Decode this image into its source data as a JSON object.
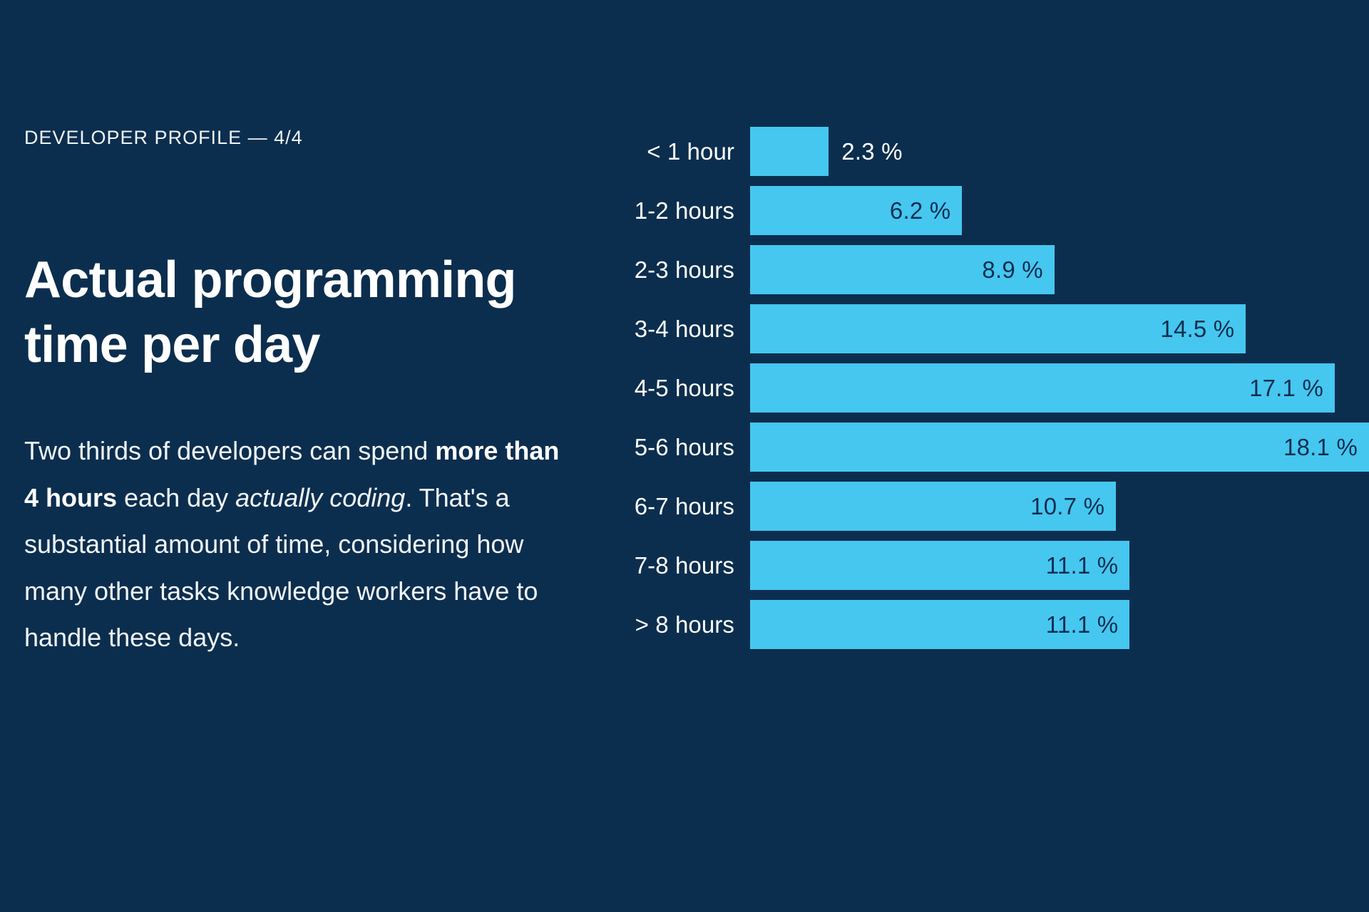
{
  "slide": {
    "background_color": "#0c2e4e",
    "eyebrow": "DEVELOPER PROFILE — 4/4",
    "headline": "Actual programming time per day",
    "body": {
      "part1": "Two thirds of developers can spend ",
      "bold1": "more than 4 hours",
      "part2": " each day ",
      "italic1": "actually coding",
      "part3": ". That's a substantial amount of time, considering how many other tasks knowledge workers have to handle these days."
    }
  },
  "chart_data": {
    "type": "bar",
    "orientation": "horizontal",
    "title": "Actual programming time per day",
    "xlabel": "",
    "ylabel": "",
    "xlim": [
      0,
      18.1
    ],
    "grid": false,
    "legend": false,
    "value_suffix": "%",
    "bar_color": "#45c7f0",
    "label_inside_color": "#0c2e4e",
    "label_outside_color": "#ffffff",
    "categories": [
      "< 1 hour",
      "1-2 hours",
      "2-3 hours",
      "3-4 hours",
      "4-5 hours",
      "5-6 hours",
      "6-7 hours",
      "7-8 hours",
      "> 8 hours"
    ],
    "values": [
      2.3,
      6.2,
      8.9,
      14.5,
      17.1,
      18.1,
      10.7,
      11.1,
      11.1
    ],
    "value_labels": [
      "2.3 %",
      "6.2 %",
      "8.9 %",
      "14.5 %",
      "17.1 %",
      "18.1 %",
      "10.7 %",
      "11.1 %",
      "11.1 %"
    ],
    "label_placement": [
      "outside",
      "inside",
      "inside",
      "inside",
      "inside",
      "inside",
      "inside",
      "inside",
      "inside"
    ]
  }
}
